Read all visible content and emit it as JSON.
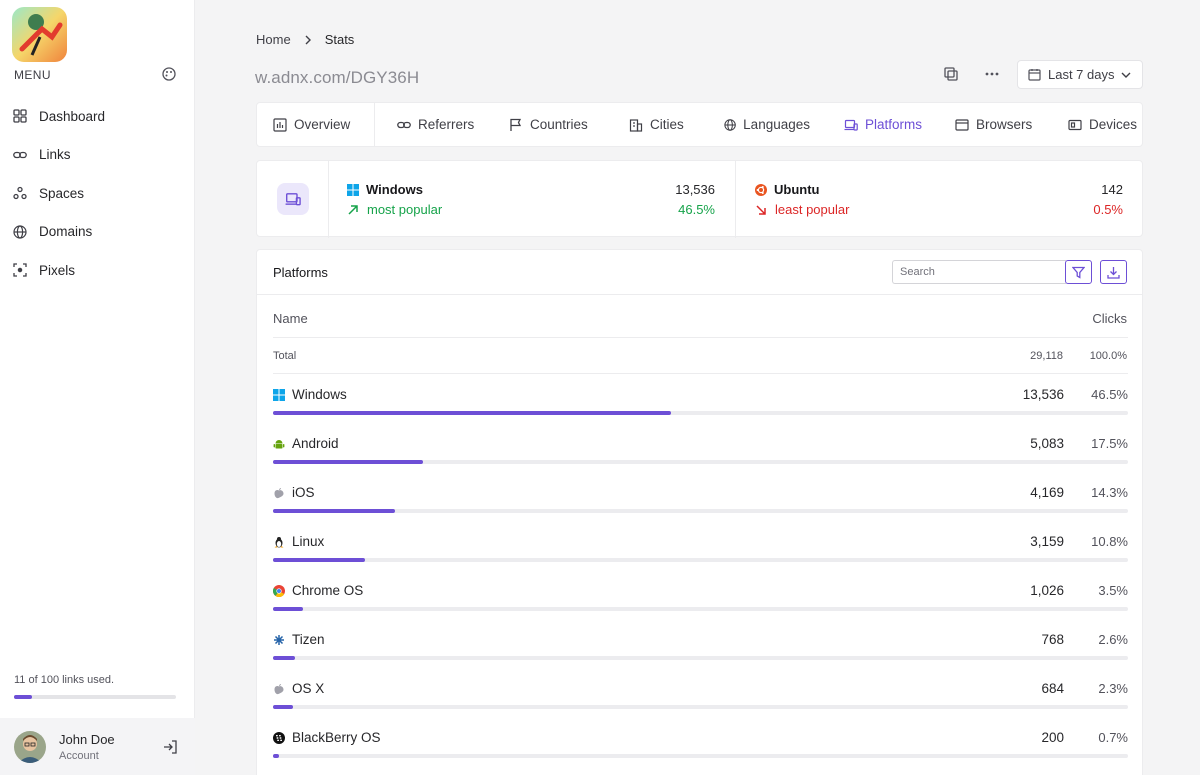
{
  "sidebar": {
    "menu_label": "MENU",
    "items": [
      {
        "label": "Dashboard",
        "icon": "dashboard-grid-icon"
      },
      {
        "label": "Links",
        "icon": "link-icon"
      },
      {
        "label": "Spaces",
        "icon": "spaces-icon"
      },
      {
        "label": "Domains",
        "icon": "globe-icon"
      },
      {
        "label": "Pixels",
        "icon": "pixel-icon"
      }
    ],
    "usage_text": "11 of 100 links used.",
    "usage_fraction": 0.11,
    "user": {
      "name": "John Doe",
      "subtitle": "Account"
    }
  },
  "breadcrumb": {
    "home": "Home",
    "current": "Stats"
  },
  "short_url": "w.adnx.com/DGY36H",
  "date_range": "Last 7 days",
  "tabs": [
    {
      "label": "Overview",
      "icon": "chart-icon"
    },
    {
      "label": "Referrers",
      "icon": "link-icon"
    },
    {
      "label": "Countries",
      "icon": "flag-icon"
    },
    {
      "label": "Cities",
      "icon": "building-icon"
    },
    {
      "label": "Languages",
      "icon": "globe-icon"
    },
    {
      "label": "Platforms",
      "icon": "devices-icon",
      "active": true
    },
    {
      "label": "Browsers",
      "icon": "browser-icon"
    },
    {
      "label": "Devices",
      "icon": "device-icon"
    }
  ],
  "summary": {
    "most": {
      "name": "Windows",
      "label": "most popular",
      "clicks": "13,536",
      "percent": "46.5%"
    },
    "least": {
      "name": "Ubuntu",
      "label": "least popular",
      "clicks": "142",
      "percent": "0.5%"
    }
  },
  "panel": {
    "title": "Platforms",
    "search_placeholder": "Search",
    "col_name": "Name",
    "col_clicks": "Clicks",
    "total": {
      "label": "Total",
      "clicks": "29,118",
      "percent": "100.0%"
    },
    "rows": [
      {
        "name": "Windows",
        "clicks": "13,536",
        "percent": "46.5%",
        "share": 46.5,
        "icon": "windows-icon"
      },
      {
        "name": "Android",
        "clicks": "5,083",
        "percent": "17.5%",
        "share": 17.5,
        "icon": "android-icon"
      },
      {
        "name": "iOS",
        "clicks": "4,169",
        "percent": "14.3%",
        "share": 14.3,
        "icon": "apple-icon"
      },
      {
        "name": "Linux",
        "clicks": "3,159",
        "percent": "10.8%",
        "share": 10.8,
        "icon": "linux-icon"
      },
      {
        "name": "Chrome OS",
        "clicks": "1,026",
        "percent": "3.5%",
        "share": 3.5,
        "icon": "chrome-icon"
      },
      {
        "name": "Tizen",
        "clicks": "768",
        "percent": "2.6%",
        "share": 2.6,
        "icon": "tizen-icon"
      },
      {
        "name": "OS X",
        "clicks": "684",
        "percent": "2.3%",
        "share": 2.3,
        "icon": "apple-icon"
      },
      {
        "name": "BlackBerry OS",
        "clicks": "200",
        "percent": "0.7%",
        "share": 0.7,
        "icon": "blackberry-icon"
      }
    ]
  },
  "colors": {
    "accent": "#6d4fd6",
    "positive": "#16a34a",
    "negative": "#dc2626"
  }
}
